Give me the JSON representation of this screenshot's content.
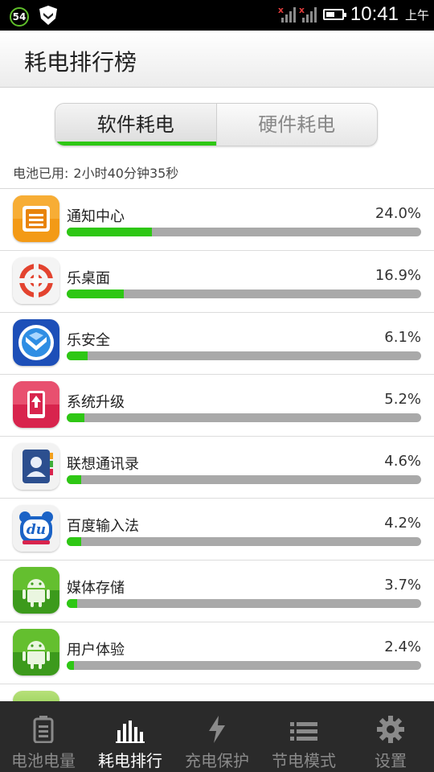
{
  "status_bar": {
    "notification_badge": "54",
    "time": "10:41",
    "ampm": "上午"
  },
  "title_bar": {
    "title": "耗电排行榜"
  },
  "segment": {
    "tabs": [
      {
        "label": "软件耗电",
        "selected": true
      },
      {
        "label": "硬件耗电",
        "selected": false
      }
    ],
    "accent_color": "#2ec714"
  },
  "battery_usage": {
    "label": "电池已用:",
    "value": "2小时40分钟35秒"
  },
  "apps": [
    {
      "name": "通知中心",
      "percent": "24.0%",
      "fraction": 0.24,
      "icon": "notification-center-icon"
    },
    {
      "name": "乐桌面",
      "percent": "16.9%",
      "fraction": 0.16,
      "icon": "launcher-icon"
    },
    {
      "name": "乐安全",
      "percent": "6.1%",
      "fraction": 0.06,
      "icon": "security-shield-icon"
    },
    {
      "name": "系统升级",
      "percent": "5.2%",
      "fraction": 0.05,
      "icon": "system-update-icon"
    },
    {
      "name": "联想通讯录",
      "percent": "4.6%",
      "fraction": 0.04,
      "icon": "contacts-icon"
    },
    {
      "name": "百度输入法",
      "percent": "4.2%",
      "fraction": 0.04,
      "icon": "baidu-ime-icon"
    },
    {
      "name": "媒体存储",
      "percent": "3.7%",
      "fraction": 0.03,
      "icon": "android-icon"
    },
    {
      "name": "用户体验",
      "percent": "2.4%",
      "fraction": 0.02,
      "icon": "android-icon"
    }
  ],
  "bottom_nav": [
    {
      "label": "电池电量",
      "icon": "battery-icon",
      "active": false
    },
    {
      "label": "耗电排行",
      "icon": "bar-chart-icon",
      "active": true
    },
    {
      "label": "充电保护",
      "icon": "lightning-icon",
      "active": false
    },
    {
      "label": "节电模式",
      "icon": "list-icon",
      "active": false
    },
    {
      "label": "设置",
      "icon": "gear-icon",
      "active": false
    }
  ]
}
